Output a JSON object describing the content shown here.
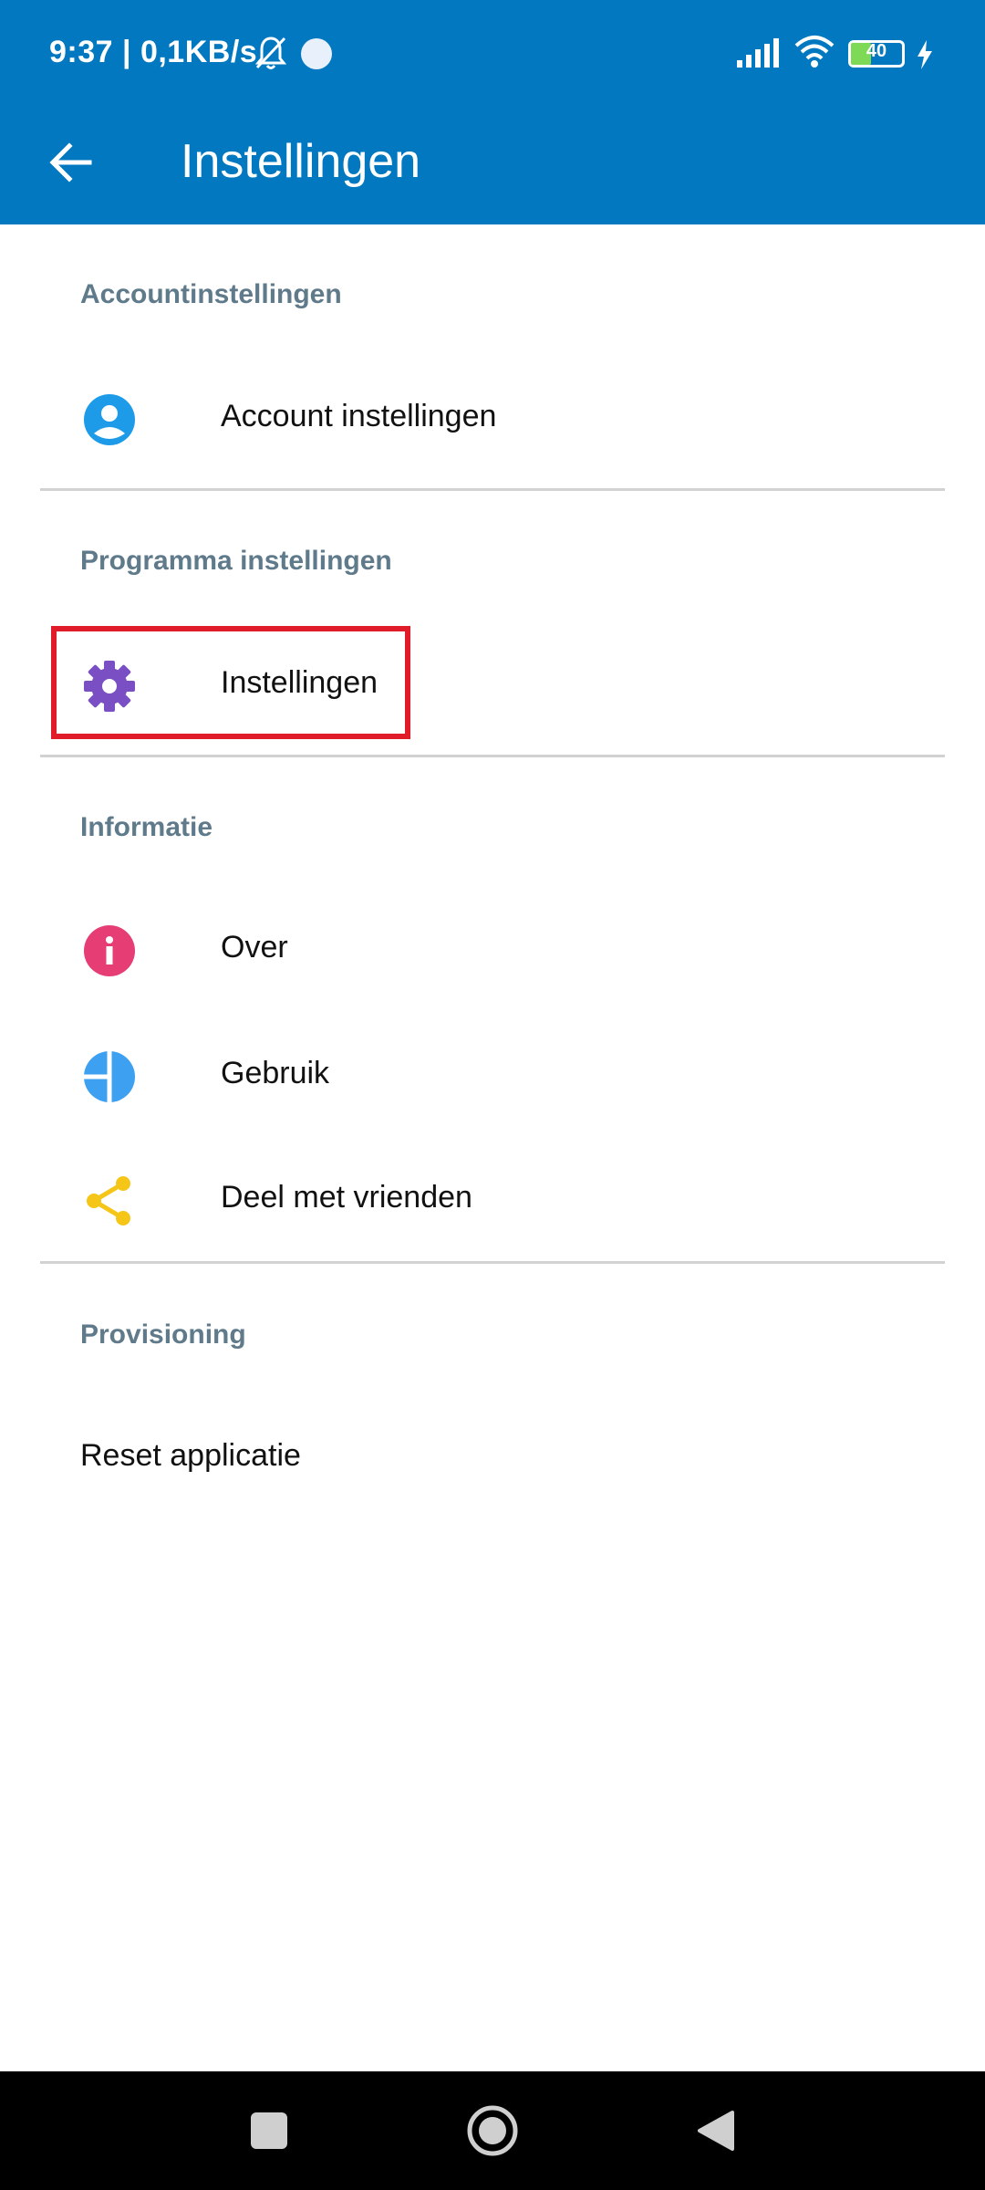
{
  "status_bar": {
    "time": "9:37 | 0,1KB/s",
    "battery": "40"
  },
  "header": {
    "title": "Instellingen",
    "accent_color": "#0178c0"
  },
  "sections": [
    {
      "header": "Accountinstellingen",
      "items": [
        {
          "label": "Account instellingen",
          "icon": "account-circle-icon"
        }
      ]
    },
    {
      "header": "Programma instellingen",
      "items": [
        {
          "label": "Instellingen",
          "icon": "gear-icon"
        }
      ]
    },
    {
      "header": "Informatie",
      "items": [
        {
          "label": "Over",
          "icon": "info-icon"
        },
        {
          "label": "Gebruik",
          "icon": "usage-pie-icon"
        },
        {
          "label": "Deel met vrienden",
          "icon": "share-icon"
        }
      ]
    },
    {
      "header": "Provisioning",
      "items": [
        {
          "label": "Reset applicatie"
        }
      ]
    }
  ],
  "colors": {
    "section_header": "#5f7a8a",
    "account_icon": "#1e9be8",
    "gear_icon": "#7b4fc4",
    "info_icon": "#e63e74",
    "usage_icon": "#3da0f0",
    "share_icon": "#f5c518",
    "highlight": "#e01b2a"
  }
}
